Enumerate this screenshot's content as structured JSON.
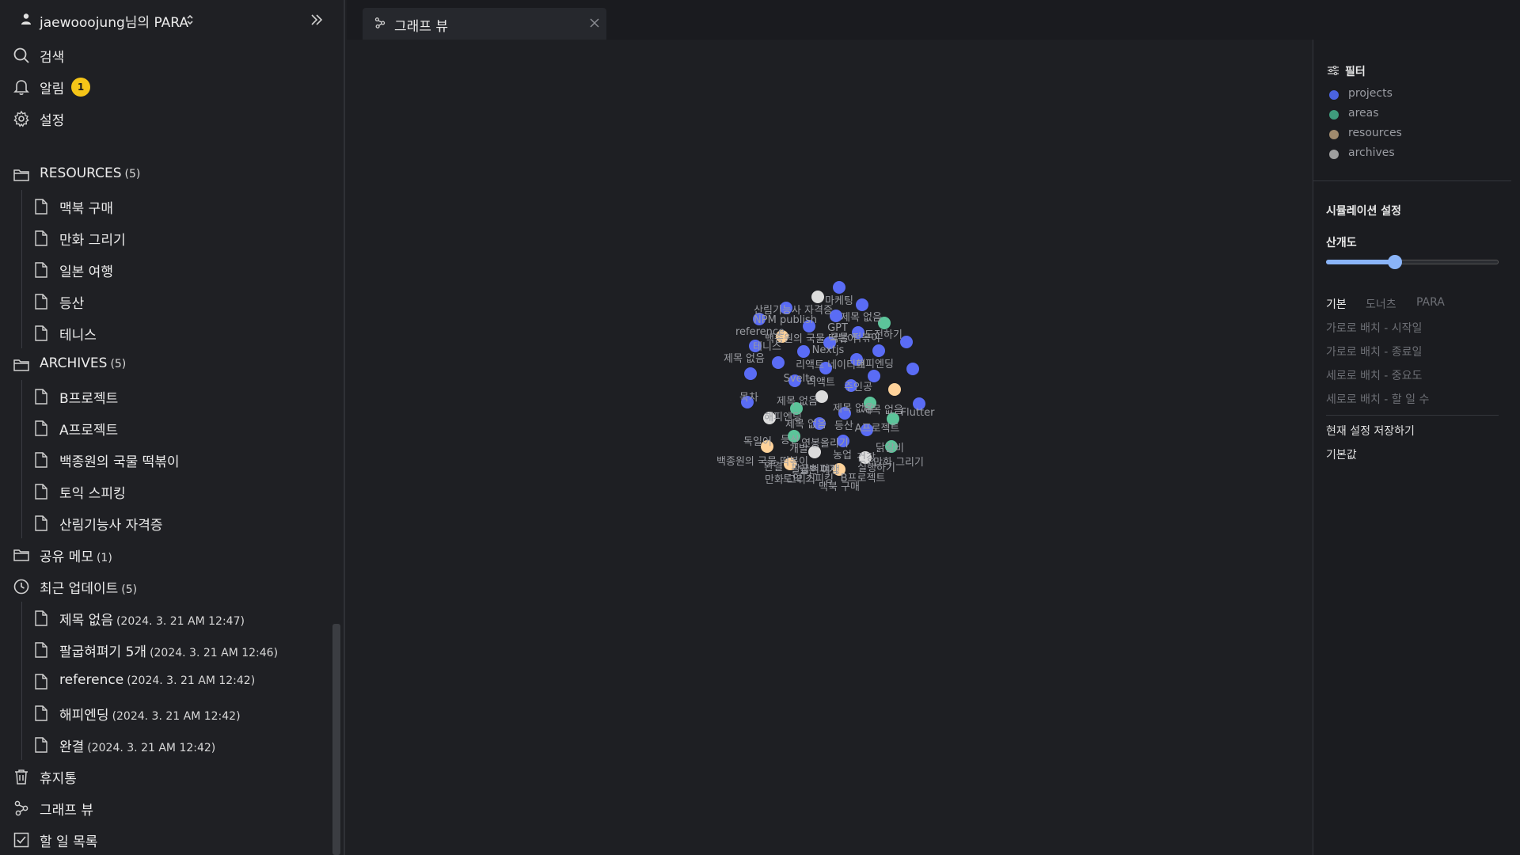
{
  "workspace": {
    "name": "jaewooojung님의 PARA"
  },
  "nav": {
    "search": "검색",
    "alerts": "알림",
    "alerts_count": "1",
    "settings": "설정"
  },
  "resources": {
    "label": "RESOURCES",
    "count": "(5)",
    "items": [
      "맥북 구매",
      "만화 그리기",
      "일본 여행",
      "등산",
      "테니스"
    ]
  },
  "archives": {
    "label": "ARCHIVES",
    "count": "(5)",
    "items": [
      "B프로젝트",
      "A프로젝트",
      "백종원의 국물 떡볶이",
      "토익 스피킹",
      "산림기능사 자격증"
    ]
  },
  "shared": {
    "label": "공유 메모",
    "count": "(1)"
  },
  "recent": {
    "label": "최근 업데이트",
    "count": "(5)",
    "items": [
      {
        "title": "제목 없음",
        "time": "(2024. 3. 21 AM 12:47)"
      },
      {
        "title": "팔굽혀펴기 5개",
        "time": "(2024. 3. 21 AM 12:46)"
      },
      {
        "title": "reference",
        "time": "(2024. 3. 21 AM 12:42)"
      },
      {
        "title": "해피엔딩",
        "time": "(2024. 3. 21 AM 12:42)"
      },
      {
        "title": "완결",
        "time": "(2024. 3. 21 AM 12:42)"
      }
    ]
  },
  "footer_nav": {
    "trash": "휴지통",
    "graph": "그래프 뷰",
    "todo": "할 일 목록"
  },
  "tab": {
    "label": "그래프 뷰"
  },
  "filter": {
    "title": "필터",
    "legend": [
      {
        "label": "projects",
        "color": "#4a63e0"
      },
      {
        "label": "areas",
        "color": "#3f9b7c"
      },
      {
        "label": "resources",
        "color": "#a08a6e"
      },
      {
        "label": "archives",
        "color": "#9e9e9e"
      }
    ]
  },
  "simulation": {
    "title": "시뮬레이션 설정",
    "spread_label": "산개도",
    "spread_value": 0.4,
    "modes": [
      "기본",
      "도너츠",
      "PARA"
    ],
    "active_mode": 0,
    "layouts": [
      "가로로 배치 - 시작일",
      "가로로 배치 - 종료일",
      "세로로 배치 - 중요도",
      "세로로 배치 - 할 일 수"
    ],
    "save": "현재 설정 저장하기",
    "reset": "기본값"
  },
  "graph": {
    "colors": {
      "project": "#5a6cf5",
      "area": "#5cc49a",
      "resource": "#ffd29a",
      "archive": "#dcdcdc",
      "label": "#9a9ca2"
    },
    "labels": [
      "마케팅",
      "산림기능사 자격증",
      "NPM publish",
      "제목 없음",
      "reference",
      "GPT",
      "도전하기",
      "백종원의 국물 떡볶이",
      "국물 떡볶이",
      "테니스",
      "Nextjs",
      "제목 없음",
      "리액트 네이티브",
      "해피엔딩",
      "Svelte",
      "리액트",
      "주인공",
      "목차",
      "제목 없음",
      "제목 없음",
      "제목 없음",
      "Flutter",
      "해피엔딩",
      "제목 없음",
      "등산",
      "A프로젝트",
      "등산",
      "연봉올리기",
      "닭갈비",
      "독일어",
      "개발",
      "농업",
      "백종원의 국물 떡볶이",
      "팔굽혀펴기",
      "건강",
      "만화 그리기",
      "완결",
      "일본 여행",
      "B프로젝트",
      "토익 스피킹",
      "실행하기",
      "만화 그리기",
      "맥북 구매"
    ]
  }
}
